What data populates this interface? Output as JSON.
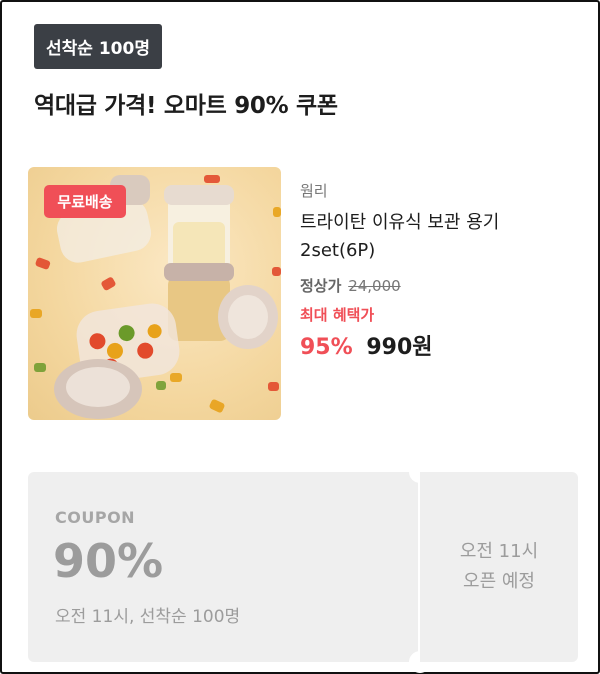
{
  "badge": "선착순 100명",
  "headline": "역대급 가격! 오마트 90% 쿠폰",
  "product": {
    "shipping_tag": "무료배송",
    "brand": "웜리",
    "name": "트라이탄 이유식 보관 용기 2set(6P)",
    "regular_label": "정상가",
    "regular_price": "24,000",
    "max_benefit_label": "최대 혜택가",
    "discount": "95%",
    "price": "990원"
  },
  "coupon": {
    "label": "COUPON",
    "percent": "90%",
    "desc": "오전 11시, 선착순 100명",
    "open_line1": "오전 11시",
    "open_line2": "오픈 예정"
  },
  "colors": {
    "accent": "#f04f57",
    "badge_bg": "#3b3f45",
    "coupon_bg": "#efefef"
  }
}
